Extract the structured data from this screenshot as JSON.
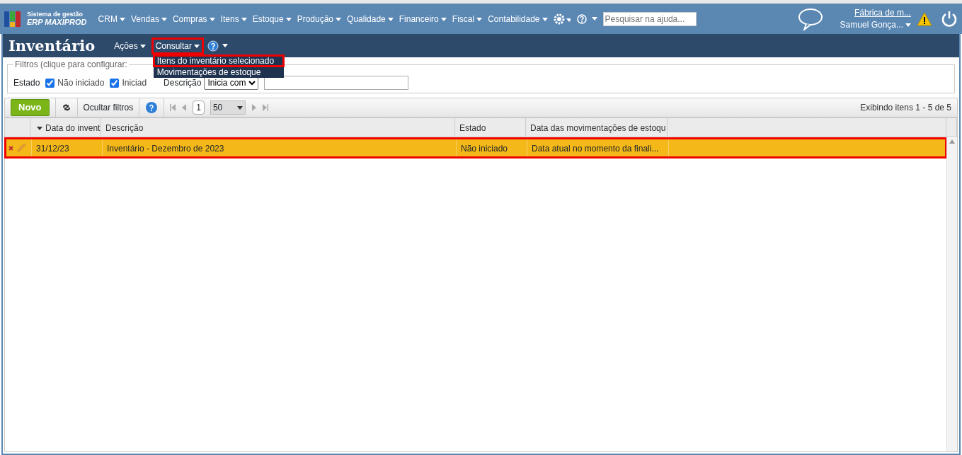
{
  "app": {
    "brand_line1": "Sistema de gestão",
    "brand_line2": "ERP MAXIPROD"
  },
  "nav": [
    {
      "label": "CRM"
    },
    {
      "label": "Vendas"
    },
    {
      "label": "Compras"
    },
    {
      "label": "Itens"
    },
    {
      "label": "Estoque"
    },
    {
      "label": "Produção"
    },
    {
      "label": "Qualidade"
    },
    {
      "label": "Financeiro"
    },
    {
      "label": "Fiscal"
    },
    {
      "label": "Contabilidade"
    }
  ],
  "help_search": {
    "placeholder": "Pesquisar na ajuda..."
  },
  "company": "Fábrica de m...",
  "user": "Samuel Gonça...",
  "page": {
    "title": "Inventário"
  },
  "page_menu": [
    {
      "label": "Ações",
      "highlighted": false
    },
    {
      "label": "Consultar",
      "highlighted": true
    }
  ],
  "consultar_menu": [
    {
      "label": "Itens do inventário selecionado",
      "highlighted": true
    },
    {
      "label": "Movimentações de estoque",
      "highlighted": false
    }
  ],
  "filters": {
    "legend": "Filtros (clique para configurar:",
    "state_label": "Estado",
    "states": [
      {
        "label": "Não iniciado",
        "checked": true
      },
      {
        "label": "Iniciad",
        "checked": true
      }
    ],
    "description_label": "Descrição",
    "match": "Inicia com"
  },
  "toolbar": {
    "new": "Novo",
    "hide_filters": "Ocultar filtros",
    "page": "1",
    "page_size": "50",
    "showing": "Exibindo itens 1 - 5 de 5"
  },
  "table": {
    "columns": [
      "Data do invent",
      "Descrição",
      "Estado",
      "Data das movimentações de estoqu"
    ],
    "rows": [
      {
        "cells": [
          "31/12/23",
          "Inventário - Dezembro de 2023",
          "Não iniciado",
          "Data atual no momento da finali..."
        ],
        "selected": true,
        "highlighted": true
      }
    ]
  }
}
